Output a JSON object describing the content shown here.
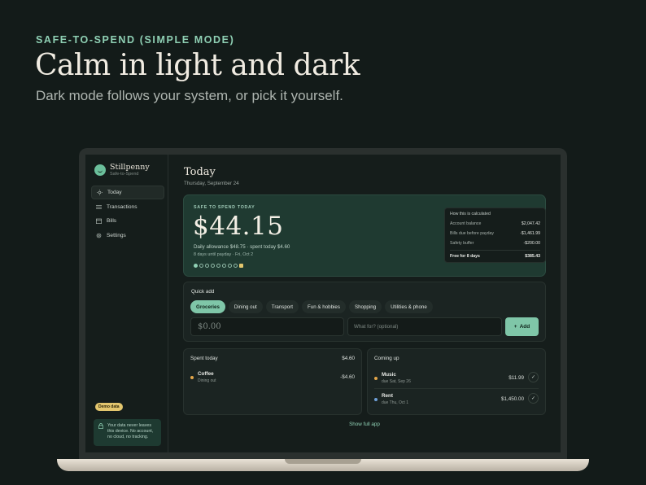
{
  "marketing": {
    "eyebrow": "SAFE-TO-SPEND (SIMPLE MODE)",
    "headline": "Calm in light and dark",
    "subhead": "Dark mode follows your system, or pick it yourself."
  },
  "app": {
    "name": "Stillpenny",
    "tagline": "Safe-to-Spend"
  },
  "sidebar": {
    "items": [
      {
        "label": "Today",
        "icon": "sun-icon",
        "active": true
      },
      {
        "label": "Transactions",
        "icon": "list-icon",
        "active": false
      },
      {
        "label": "Bills",
        "icon": "calendar-icon",
        "active": false
      },
      {
        "label": "Settings",
        "icon": "gear-icon",
        "active": false
      }
    ],
    "demo_badge": "Demo data",
    "privacy_note": "Your data never leaves this device. No account, no cloud, no tracking."
  },
  "page": {
    "title": "Today",
    "date": "Thursday, September 24"
  },
  "hero": {
    "label": "SAFE TO SPEND TODAY",
    "amount": "$44.15",
    "allowance": "Daily allowance $48.75 · spent today $4.60",
    "payday": "8 days until payday · Fri, Oct 2",
    "days_total": 9,
    "days_elapsed": 1
  },
  "calculation": {
    "title": "How this is calculated",
    "rows": [
      {
        "label": "Account balance",
        "value": "$2,047.42"
      },
      {
        "label": "Bills due before payday",
        "value": "-$1,461.99"
      },
      {
        "label": "Safety buffer",
        "value": "-$200.00"
      }
    ],
    "total_label": "Free for 8 days",
    "total_value": "$385.43"
  },
  "quick_add": {
    "title": "Quick add",
    "categories": [
      "Groceries",
      "Dining out",
      "Transport",
      "Fun & hobbies",
      "Shopping",
      "Utilities & phone"
    ],
    "selected_category": "Groceries",
    "amount_placeholder": "$0.00",
    "note_placeholder": "What for? (optional)",
    "add_label": "Add"
  },
  "spent_today": {
    "title": "Spent today",
    "total": "$4.60",
    "items": [
      {
        "name": "Coffee",
        "category": "Dining out",
        "amount": "-$4.60"
      }
    ]
  },
  "coming_up": {
    "title": "Coming up",
    "items": [
      {
        "name": "Music",
        "due": "due Sat, Sep 26",
        "amount": "$11.99"
      },
      {
        "name": "Rent",
        "due": "due Thu, Oct 1",
        "amount": "$1,450.00"
      }
    ]
  },
  "footer": {
    "show_full_app": "Show full app"
  },
  "colors": {
    "accent": "#7fc6a8",
    "highlight": "#e3c66e",
    "upcoming_dot_music": "#e3a64a",
    "upcoming_dot_rent": "#6f9fd8",
    "spent_dot": "#e3a64a"
  }
}
